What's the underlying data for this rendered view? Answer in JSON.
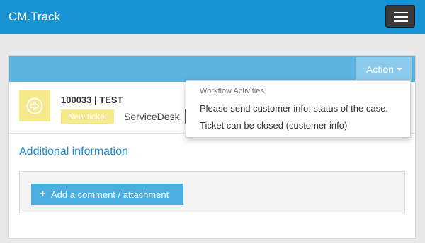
{
  "navbar": {
    "brand": "CM.Track",
    "menu_icon": "hamburger-icon"
  },
  "panel": {
    "action_label": "Action",
    "caret_icon": "caret-down-icon"
  },
  "ticket": {
    "icon": "arrow-circle-right-icon",
    "title": "100033 | TEST",
    "status_badge": "New ticket",
    "department": "ServiceDesk"
  },
  "section": {
    "title": "Additional information",
    "add_button_icon": "plus-icon",
    "add_button_label": "Add a comment / attachment"
  },
  "dropdown": {
    "header": "Workflow Activities",
    "items": [
      {
        "label": "Please send customer info: status of the case."
      },
      {
        "label": "Ticket can be closed (customer info)"
      }
    ]
  },
  "colors": {
    "navbar": "#1a93d4",
    "panel_header": "#5cb3e0",
    "accent": "#1a8bd0",
    "badge": "#f6e98a",
    "button": "#4aaee0"
  }
}
